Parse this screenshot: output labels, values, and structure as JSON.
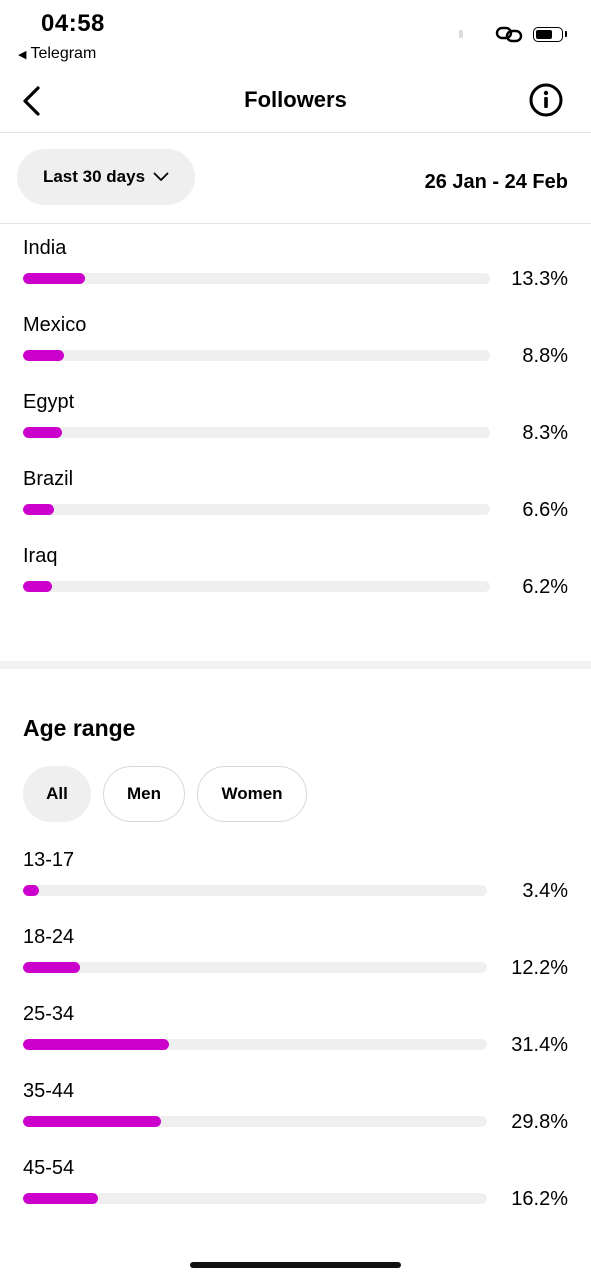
{
  "status_bar": {
    "time": "04:58",
    "back_app": "Telegram",
    "icons": [
      "link-icon",
      "battery-icon"
    ]
  },
  "header": {
    "title": "Followers",
    "back_icon": "chevron-left-icon",
    "info_icon": "info-icon"
  },
  "filter": {
    "range_label": "Last 30 days",
    "date_range": "26 Jan - 24 Feb"
  },
  "accent_color": "#cc00cc",
  "countries": [
    {
      "label": "India",
      "percent": "13.3%",
      "value": 13.3
    },
    {
      "label": "Mexico",
      "percent": "8.8%",
      "value": 8.8
    },
    {
      "label": "Egypt",
      "percent": "8.3%",
      "value": 8.3
    },
    {
      "label": "Brazil",
      "percent": "6.6%",
      "value": 6.6
    },
    {
      "label": "Iraq",
      "percent": "6.2%",
      "value": 6.2
    }
  ],
  "age_range": {
    "title": "Age range",
    "tabs": [
      {
        "label": "All",
        "active": true
      },
      {
        "label": "Men",
        "active": false
      },
      {
        "label": "Women",
        "active": false
      }
    ],
    "items": [
      {
        "label": "13-17",
        "percent": "3.4%",
        "value": 3.4
      },
      {
        "label": "18-24",
        "percent": "12.2%",
        "value": 12.2
      },
      {
        "label": "25-34",
        "percent": "31.4%",
        "value": 31.4
      },
      {
        "label": "35-44",
        "percent": "29.8%",
        "value": 29.8
      },
      {
        "label": "45-54",
        "percent": "16.2%",
        "value": 16.2
      }
    ]
  }
}
